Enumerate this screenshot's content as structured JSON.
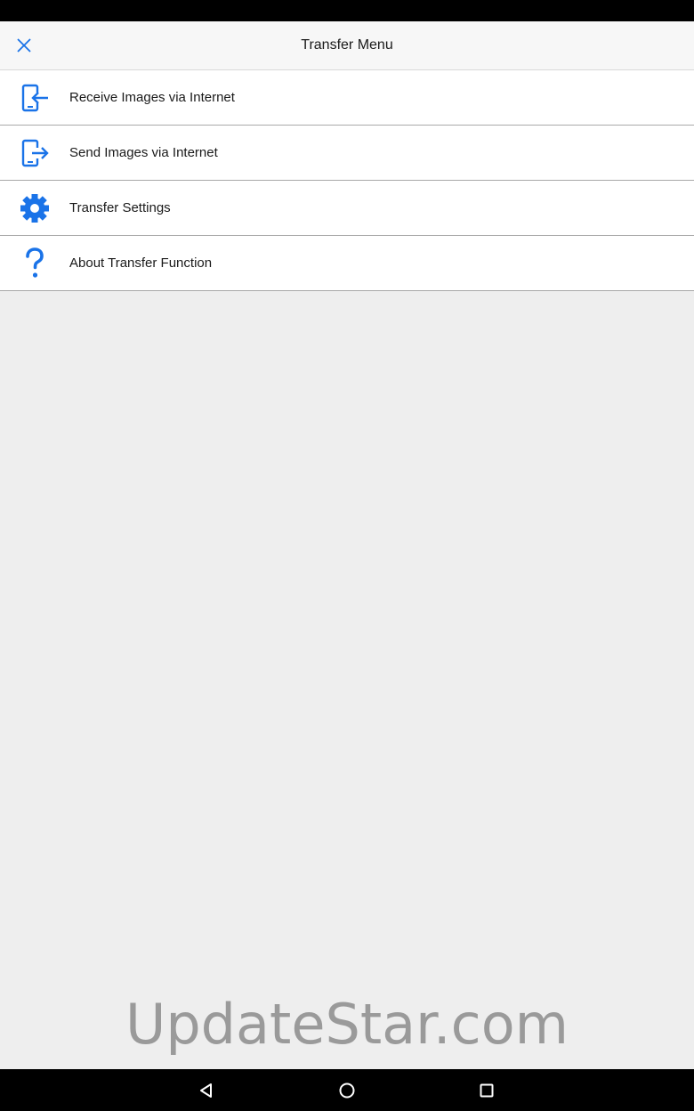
{
  "header": {
    "title": "Transfer Menu",
    "close_icon": "close-icon"
  },
  "menu": {
    "items": [
      {
        "label": "Receive Images via Internet",
        "icon": "receive-phone-icon"
      },
      {
        "label": "Send Images via Internet",
        "icon": "send-phone-icon"
      },
      {
        "label": "Transfer Settings",
        "icon": "gear-icon"
      },
      {
        "label": "About Transfer Function",
        "icon": "question-mark-icon"
      }
    ]
  },
  "watermark": {
    "text": "UpdateStar.com"
  },
  "navbar": {
    "back_icon": "back-triangle-icon",
    "home_icon": "home-circle-icon",
    "recents_icon": "recents-square-icon"
  },
  "colors": {
    "accent": "#1a73e8",
    "background": "#eeeeee",
    "list_background": "#ffffff",
    "divider": "#a9a9a9"
  }
}
